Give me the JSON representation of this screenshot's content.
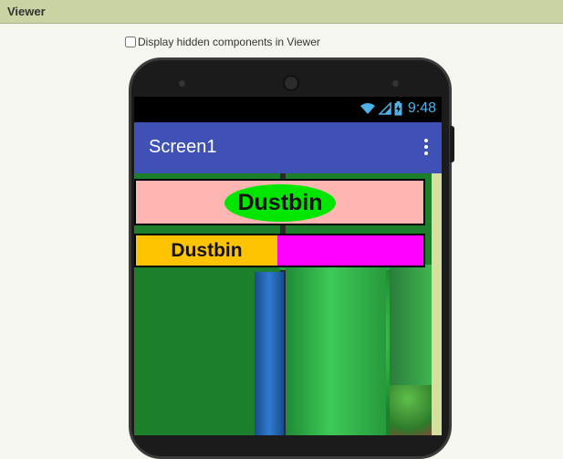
{
  "viewer": {
    "title": "Viewer",
    "hidden_components_label": "Display hidden components in Viewer",
    "hidden_components_checked": false
  },
  "device": {
    "status_time": "9:48",
    "status_icons": [
      "wifi-icon",
      "signal-icon",
      "battery-icon"
    ]
  },
  "app": {
    "screen_title": "Screen1",
    "menu_icon": "overflow-menu-icon",
    "oval_label": "Dustbin",
    "label_left": "Dustbin",
    "colors": {
      "appbar": "#3f51b5",
      "row1_bg": "#ffb6b2",
      "oval_bg": "#00e600",
      "row2_left": "#ffc400",
      "row2_right": "#ff00ff"
    }
  }
}
